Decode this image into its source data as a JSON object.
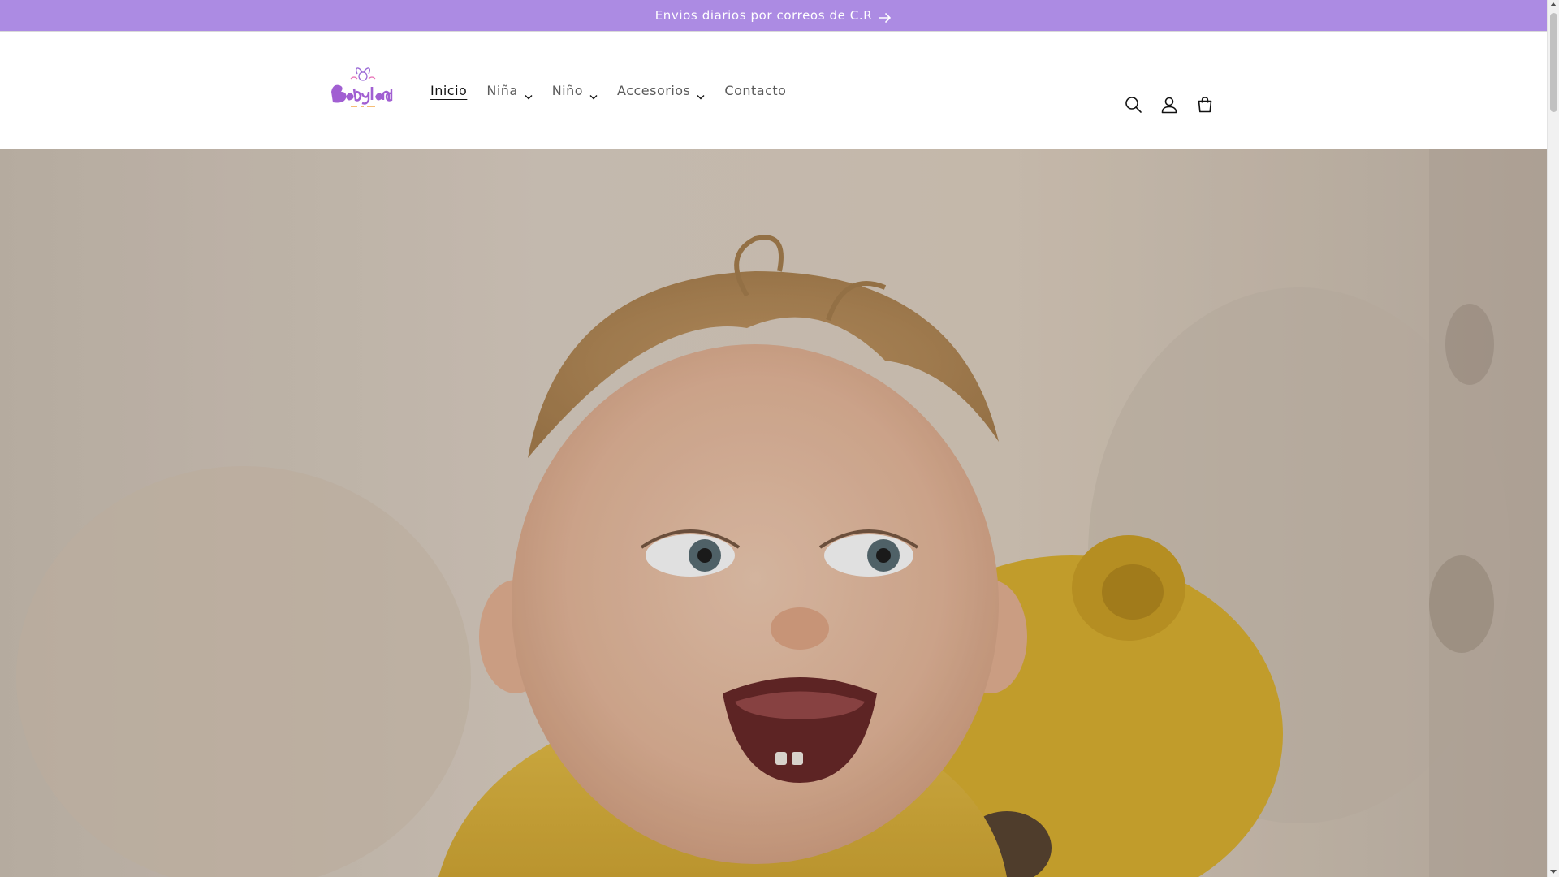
{
  "announcement": {
    "text": "Envios diarios por correos de C.R",
    "arrow_icon": "arrow-right-icon",
    "background_color": "#ac8be3"
  },
  "header": {
    "logo": {
      "alt": "Babyland"
    },
    "nav": [
      {
        "label": "Inicio",
        "active": true,
        "has_dropdown": false
      },
      {
        "label": "Niña",
        "active": false,
        "has_dropdown": true
      },
      {
        "label": "Niño",
        "active": false,
        "has_dropdown": true
      },
      {
        "label": "Accesorios",
        "active": false,
        "has_dropdown": true
      },
      {
        "label": "Contacto",
        "active": false,
        "has_dropdown": false
      }
    ],
    "icons": [
      "search-icon",
      "account-icon",
      "cart-icon"
    ]
  },
  "hero": {
    "image_description_icon": "hero-image-icon"
  },
  "colors": {
    "accent": "#ac8be3",
    "text": "#121212",
    "nav_text": "#5a5a5a"
  }
}
